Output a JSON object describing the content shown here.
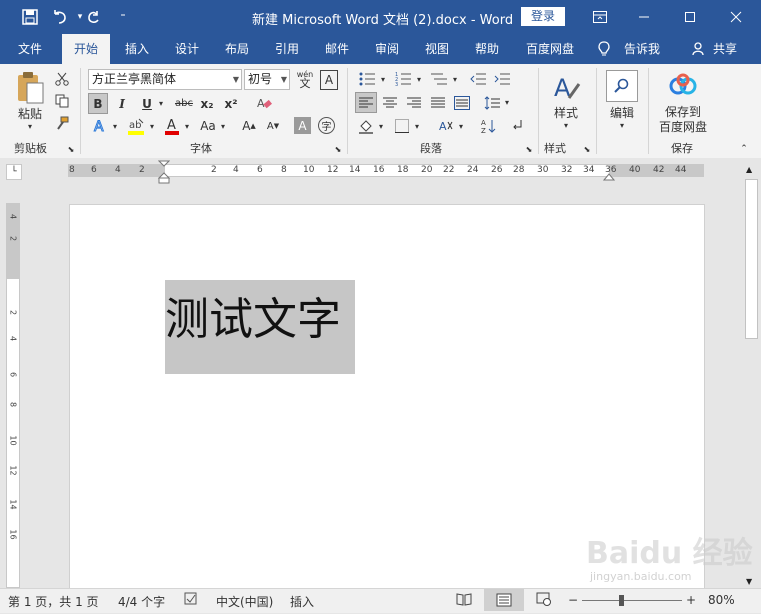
{
  "titlebar": {
    "title": "新建 Microsoft Word 文档 (2).docx  -  Word",
    "login": "登录",
    "quick_access": {
      "save": "save-icon",
      "undo": "undo-icon",
      "redo": "redo-icon",
      "customize": "customize-icon"
    }
  },
  "tabs": [
    "文件",
    "开始",
    "插入",
    "设计",
    "布局",
    "引用",
    "邮件",
    "审阅",
    "视图",
    "帮助",
    "百度网盘"
  ],
  "tellme": "告诉我",
  "share": "共享",
  "ribbon": {
    "clipboard": {
      "paste": "粘贴",
      "label": "剪贴板"
    },
    "font": {
      "name": "方正兰亭黑简体",
      "size": "初号",
      "label": "字体",
      "bold": "B",
      "italic": "I",
      "underline": "U",
      "strike": "abc",
      "subscript": "x₂",
      "superscript": "x²",
      "grow": "A",
      "shrink": "A",
      "case": "Aa",
      "pinyin_top": "wén",
      "pinyin_bot": "文"
    },
    "paragraph": {
      "label": "段落"
    },
    "styles": {
      "button": "样式",
      "label": "样式"
    },
    "editing": {
      "button": "编辑"
    },
    "save": {
      "button_line1": "保存到",
      "button_line2": "百度网盘",
      "label": "保存"
    }
  },
  "ruler": {
    "h_ticks": [
      "8",
      "6",
      "4",
      "2",
      "2",
      "4",
      "6",
      "8",
      "10",
      "12",
      "14",
      "16",
      "18",
      "20",
      "22",
      "24",
      "26",
      "28",
      "30",
      "32",
      "34",
      "36",
      "40",
      "42",
      "44"
    ],
    "v_ticks": [
      "4",
      "2",
      "2",
      "4",
      "6",
      "8",
      "10",
      "12",
      "14",
      "16"
    ]
  },
  "document": {
    "text": "测试文字"
  },
  "status": {
    "page": "第 1 页，共 1 页",
    "words": "4/4 个字",
    "lang": "中文(中国)",
    "mode": "插入",
    "zoom": "80%",
    "zoom_minus": "−",
    "zoom_plus": "+"
  },
  "watermark": {
    "brand": "Baidu 经验",
    "url": "jingyan.baidu.com"
  },
  "colors": {
    "accent": "#2b579a",
    "selection": "#c6c6c6",
    "highlight": "#ffff00",
    "fontcolor": "#e00000"
  }
}
